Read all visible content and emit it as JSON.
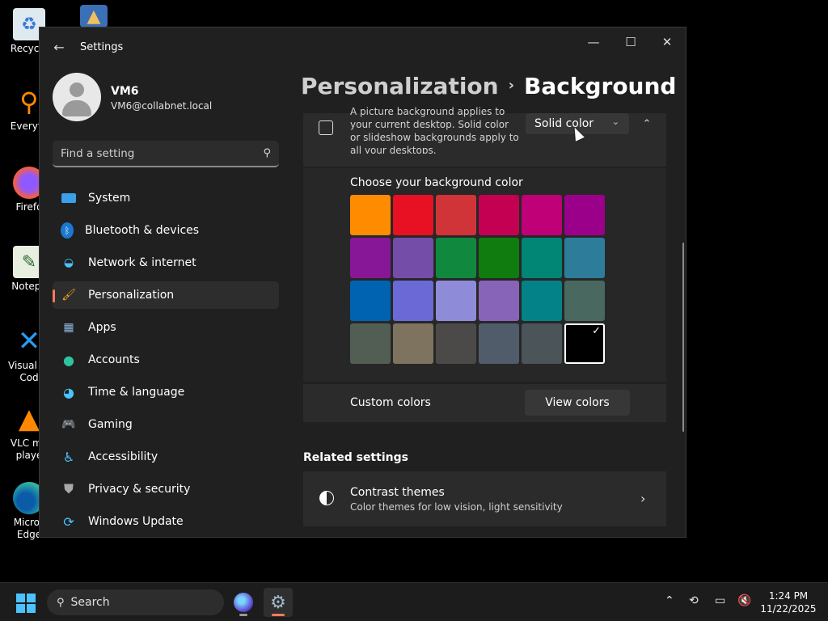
{
  "desktop": {
    "icons": [
      {
        "label": "Recycle",
        "icon": "recycle-bin-icon"
      },
      {
        "label": "Everyth",
        "icon": "everything-search-icon"
      },
      {
        "label": "Firefo",
        "icon": "firefox-icon"
      },
      {
        "label": "Notepa",
        "icon": "notepad-icon"
      },
      {
        "label": "Visual St\nCod",
        "icon": "vscode-icon"
      },
      {
        "label": "VLC me\nplaye",
        "icon": "vlc-icon"
      },
      {
        "label": "Micros\nEdge",
        "icon": "edge-icon"
      }
    ]
  },
  "window": {
    "title": "Settings",
    "controls": {
      "minimize": "—",
      "maximize": "☐",
      "close": "✕"
    }
  },
  "user": {
    "name": "VM6",
    "email": "VM6@collabnet.local"
  },
  "search": {
    "placeholder": "Find a setting"
  },
  "nav": {
    "items": [
      {
        "label": "System",
        "icon": "display-icon",
        "selected": false
      },
      {
        "label": "Bluetooth & devices",
        "icon": "bluetooth-icon",
        "selected": false
      },
      {
        "label": "Network & internet",
        "icon": "wifi-icon",
        "selected": false
      },
      {
        "label": "Personalization",
        "icon": "paintbrush-icon",
        "selected": true
      },
      {
        "label": "Apps",
        "icon": "apps-icon",
        "selected": false
      },
      {
        "label": "Accounts",
        "icon": "person-icon",
        "selected": false
      },
      {
        "label": "Time & language",
        "icon": "globe-clock-icon",
        "selected": false
      },
      {
        "label": "Gaming",
        "icon": "gamepad-icon",
        "selected": false
      },
      {
        "label": "Accessibility",
        "icon": "accessibility-icon",
        "selected": false
      },
      {
        "label": "Privacy & security",
        "icon": "shield-icon",
        "selected": false
      },
      {
        "label": "Windows Update",
        "icon": "update-icon",
        "selected": false
      }
    ]
  },
  "breadcrumb": {
    "parent": "Personalization",
    "separator": "›",
    "current": "Background"
  },
  "background": {
    "description": "A picture background applies to your current desktop. Solid color or slideshow backgrounds apply to all your desktops.",
    "dropdown_value": "Solid color",
    "colors_title": "Choose your background color",
    "swatches": [
      "#ff8c00",
      "#e81123",
      "#d13438",
      "#c30052",
      "#bf0077",
      "#9a0089",
      "#881798",
      "#744da9",
      "#10893e",
      "#107c10",
      "#018574",
      "#2d7d9a",
      "#0063b1",
      "#6b69d6",
      "#8e8cd8",
      "#8764b8",
      "#038387",
      "#486860",
      "#525e54",
      "#7e735f",
      "#4c4a48",
      "#515c6b",
      "#4a5459",
      "#000000"
    ],
    "selected_swatch": 23,
    "custom_label": "Custom colors",
    "view_colors_label": "View colors"
  },
  "related": {
    "title": "Related settings",
    "contrast_title": "Contrast themes",
    "contrast_subtitle": "Color themes for low vision, light sensitivity"
  },
  "taskbar": {
    "search_label": "Search",
    "time": "1:24 PM",
    "date": "11/22/2025"
  }
}
